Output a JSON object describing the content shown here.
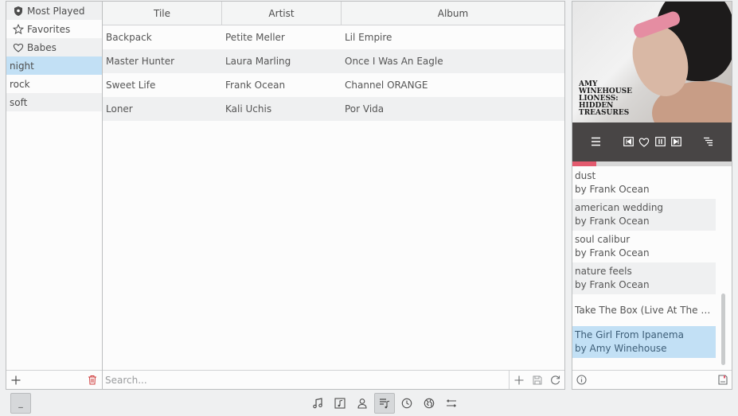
{
  "sidebar": {
    "items": [
      {
        "label": "Most Played",
        "icon": "shield-icon"
      },
      {
        "label": "Favorites",
        "icon": "star-icon"
      },
      {
        "label": "Babes",
        "icon": "heart-icon"
      },
      {
        "label": "night",
        "icon": ""
      },
      {
        "label": "rock",
        "icon": ""
      },
      {
        "label": "soft",
        "icon": ""
      }
    ],
    "selected": "night",
    "footer": {
      "add_icon": "plus-icon",
      "delete_icon": "trash-icon"
    }
  },
  "table": {
    "columns": [
      "Tile",
      "Artist",
      "Album"
    ],
    "rows": [
      [
        "Backpack",
        "Petite Meller",
        "Lil Empire"
      ],
      [
        "Master Hunter",
        "Laura Marling",
        "Once I Was An Eagle"
      ],
      [
        "Sweet Life",
        "Frank Ocean",
        "Channel ORANGE"
      ],
      [
        "Loner",
        "Kali Uchis",
        "Por Vida"
      ]
    ],
    "search_placeholder": "Search..."
  },
  "player": {
    "cover_text": "AMY WINEHOUSE LIONESS: HIDDEN TREASURES",
    "progress_fraction": 0.15,
    "accent_color": "#e35a6e"
  },
  "queue": [
    {
      "title": "dust",
      "artist": "by Frank Ocean"
    },
    {
      "title": "american wedding",
      "artist": "by Frank Ocean"
    },
    {
      "title": "soul calibur",
      "artist": "by Frank Ocean"
    },
    {
      "title": "nature feels",
      "artist": "by Frank Ocean"
    },
    {
      "title": "Take The Box (Live At The Co...",
      "artist": ""
    },
    {
      "title": "The Girl From Ipanema",
      "artist": "by Amy Winehouse"
    }
  ],
  "bottom_bar": {
    "left_button_label": "_",
    "views": [
      "music-note-icon",
      "music-library-icon",
      "artist-icon",
      "playlist-icon",
      "history-icon",
      "globe-icon",
      "settings-sliders-icon"
    ],
    "active_view": "playlist-icon"
  }
}
